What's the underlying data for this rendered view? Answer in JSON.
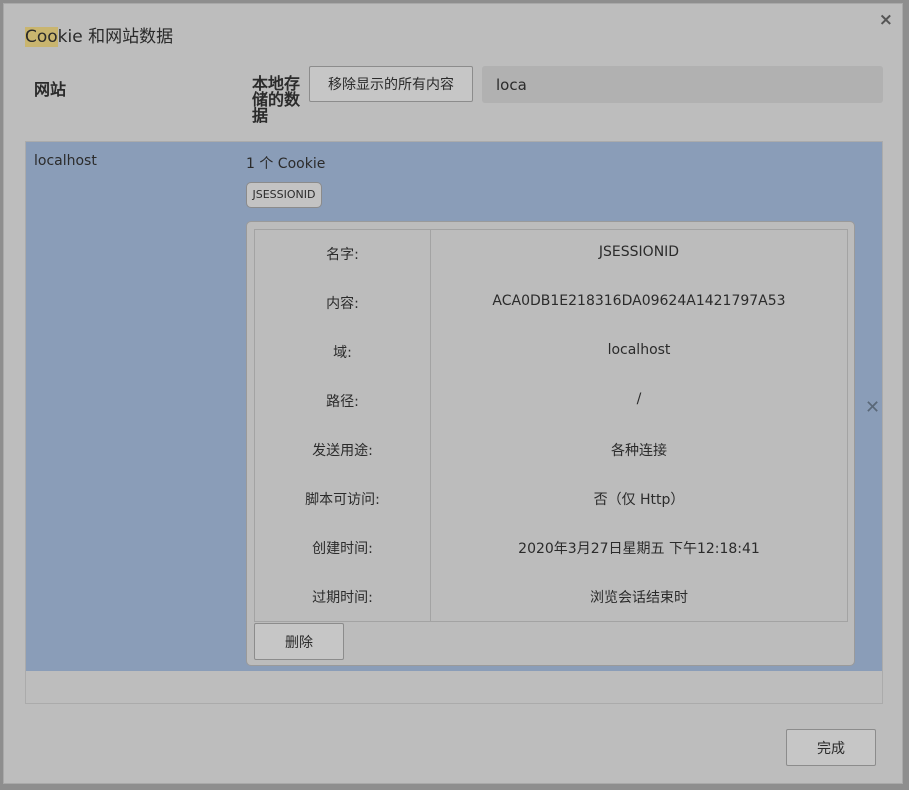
{
  "dialog": {
    "title_highlight": "Coo",
    "title_rest": "kie 和网站数据",
    "close_glyph": "×"
  },
  "header": {
    "site_column": "网站",
    "local_data_column": "本地存储的数据",
    "remove_all_label": "移除显示的所有内容",
    "search_value": "loca"
  },
  "site": {
    "name": "localhost",
    "cookie_count": "1 个 Cookie",
    "cookie_chip": "JSESSIONID",
    "row_close_glyph": "✕"
  },
  "cookie_fields": [
    {
      "label": "名字:",
      "value": "JSESSIONID"
    },
    {
      "label": "内容:",
      "value": "ACA0DB1E218316DA09624A1421797A53"
    },
    {
      "label": "域:",
      "value": "localhost"
    },
    {
      "label": "路径:",
      "value": "/"
    },
    {
      "label": "发送用途:",
      "value": "各种连接"
    },
    {
      "label": "脚本可访问:",
      "value": "否（仅 Http）"
    },
    {
      "label": "创建时间:",
      "value": "2020年3月27日星期五 下午12:18:41"
    },
    {
      "label": "过期时间:",
      "value": "浏览会话结束时"
    }
  ],
  "actions": {
    "delete_label": "删除",
    "done_label": "完成"
  }
}
